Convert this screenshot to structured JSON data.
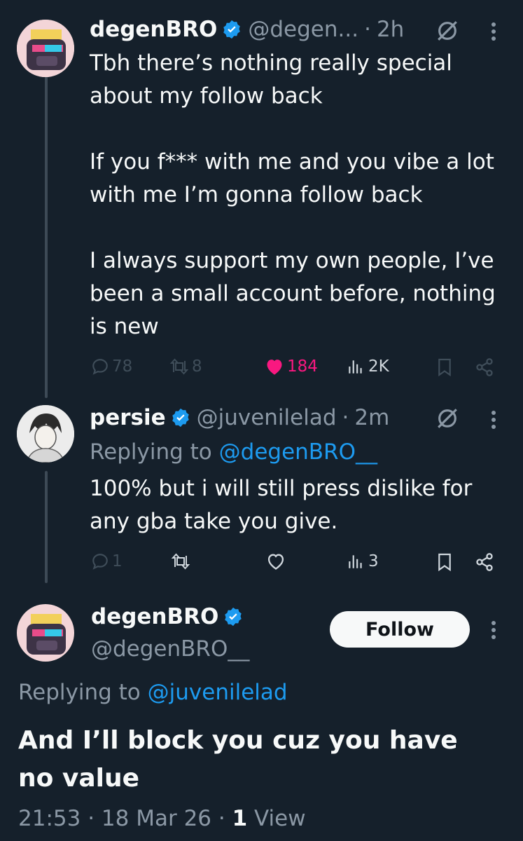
{
  "colors": {
    "background": "#15202b",
    "text": "#f7f9f9",
    "secondary": "#8b98a5",
    "accent": "#1d9bf0",
    "like": "#f91880",
    "follow_button_bg": "#f7f9f9"
  },
  "tweets": [
    {
      "display_name": "degenBRO",
      "handle": "@degen...",
      "time": "2h",
      "text": "Tbh there’s nothing really special about my follow back\n\nIf you f*** with me and you vibe a lot with me I’m gonna follow back\n\nI always support my own people, I’ve been a small account before, nothing is new",
      "replies": "78",
      "retweets": "8",
      "likes": "184",
      "views": "2K",
      "liked": true
    },
    {
      "display_name": "persie",
      "handle": "@juvenilelad",
      "time": "2m",
      "replying_prefix": "Replying to",
      "replying_to": "@degenBRO__",
      "text": "100% but i will still press dislike for any gba take you give.",
      "replies": "1",
      "views": "3"
    }
  ],
  "main_tweet": {
    "display_name": "degenBRO",
    "handle": "@degenBRO__",
    "follow_label": "Follow",
    "replying_prefix": "Replying to",
    "replying_to": "@juvenilelad",
    "text": "And I’ll block you cuz you have no value",
    "time": "21:53",
    "date": "18 Mar 26",
    "views_count": "1",
    "views_label": "View"
  },
  "icons": {
    "verified": "verified-badge-icon",
    "grok": "grok-icon",
    "more": "more-vertical-icon",
    "reply": "reply-icon",
    "retweet": "retweet-icon",
    "like": "heart-icon",
    "views": "views-chart-icon",
    "bookmark": "bookmark-icon",
    "share": "share-icon"
  }
}
